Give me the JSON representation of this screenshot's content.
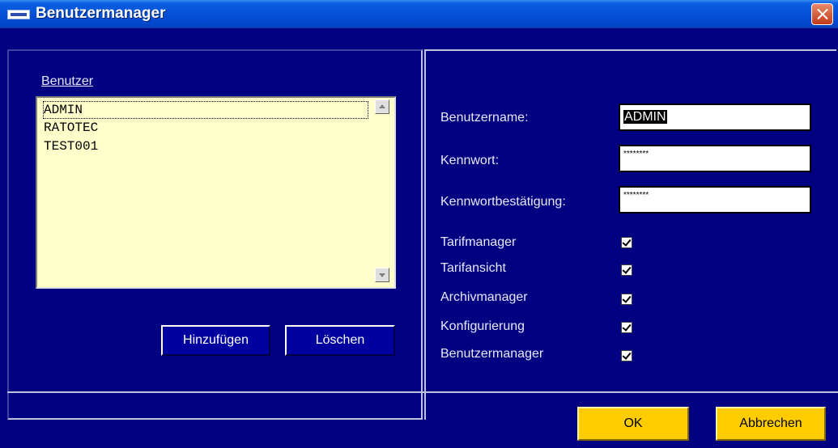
{
  "window": {
    "title": "Benutzermanager",
    "app_icon": "ratotec-icon",
    "close_icon": "close-icon"
  },
  "users": {
    "label": "Benutzer",
    "items": [
      "ADMIN",
      "RATOTEC",
      "TEST001"
    ],
    "selected": "ADMIN",
    "add_label": "Hinzufügen",
    "delete_label": "Löschen"
  },
  "form": {
    "username_label": "Benutzername:",
    "username_value": "ADMIN",
    "password_label": "Kennwort:",
    "password_value": "********",
    "confirm_label": "Kennwortbestätigung:",
    "confirm_value": "********"
  },
  "permissions": [
    {
      "label": "Tarifmanager",
      "checked": true
    },
    {
      "label": "Tarifansicht",
      "checked": true
    },
    {
      "label": "Archivmanager",
      "checked": true
    },
    {
      "label": "Konfigurierung",
      "checked": true
    },
    {
      "label": "Benutzermanager",
      "checked": true
    }
  ],
  "footer": {
    "ok_label": "OK",
    "cancel_label": "Abbrechen"
  },
  "colors": {
    "background": "#000080",
    "list_background": "#ffffcc",
    "action_button": "#ffcc00",
    "titlebar": "#0550d8"
  }
}
